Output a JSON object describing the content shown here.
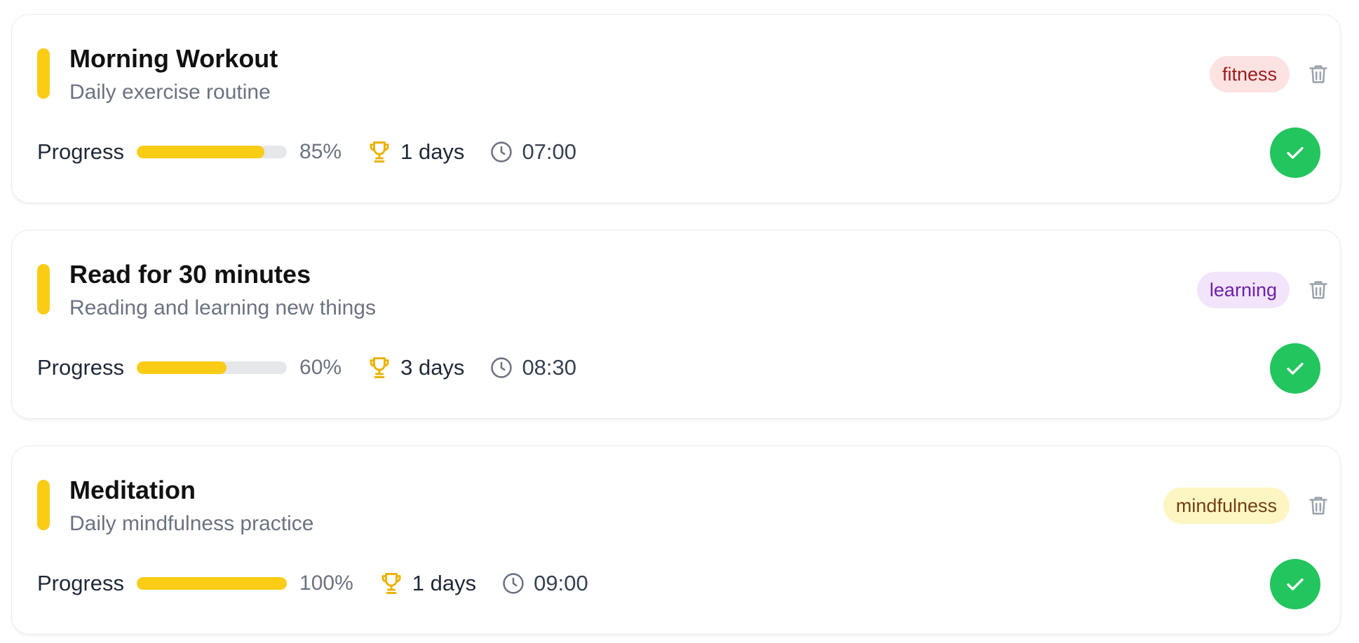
{
  "colors": {
    "accent": "#facc15",
    "complete": "#22c55e",
    "track": "#e5e7eb"
  },
  "habits": [
    {
      "title": "Morning Workout",
      "subtitle": "Daily exercise routine",
      "tag": {
        "label": "fitness",
        "bg": "#fde2e2",
        "fg": "#9b1c1c"
      },
      "progress_label": "Progress",
      "progress": 0.85,
      "progress_text": "85%",
      "streak": "1 days",
      "time": "07:00",
      "icons": {
        "accent": "accent-bar",
        "delete": "trash-icon",
        "streak": "trophy-icon",
        "time": "clock-icon",
        "complete": "check-icon"
      }
    },
    {
      "title": "Read for 30 minutes",
      "subtitle": "Reading and learning new things",
      "tag": {
        "label": "learning",
        "bg": "#f1e4fb",
        "fg": "#6b21a8"
      },
      "progress_label": "Progress",
      "progress": 0.6,
      "progress_text": "60%",
      "streak": "3 days",
      "time": "08:30",
      "icons": {
        "accent": "accent-bar",
        "delete": "trash-icon",
        "streak": "trophy-icon",
        "time": "clock-icon",
        "complete": "check-icon"
      }
    },
    {
      "title": "Meditation",
      "subtitle": "Daily mindfulness practice",
      "tag": {
        "label": "mindfulness",
        "bg": "#fdf6c3",
        "fg": "#713f12"
      },
      "progress_label": "Progress",
      "progress": 1.0,
      "progress_text": "100%",
      "streak": "1 days",
      "time": "09:00",
      "icons": {
        "accent": "accent-bar",
        "delete": "trash-icon",
        "streak": "trophy-icon",
        "time": "clock-icon",
        "complete": "check-icon"
      }
    }
  ]
}
